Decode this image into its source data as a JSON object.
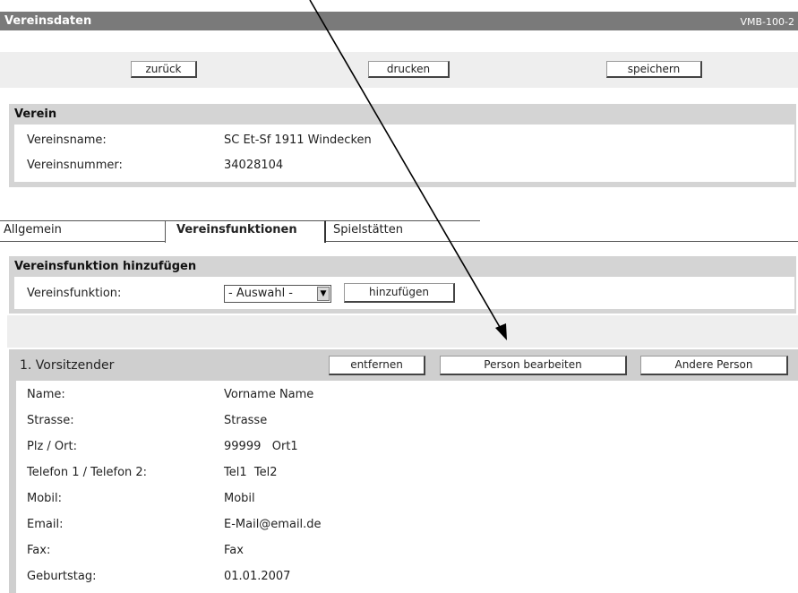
{
  "header": {
    "title": "Vereinsdaten",
    "code": "VMB-100-2"
  },
  "toolbar": {
    "back": "zurück",
    "print": "drucken",
    "save": "speichern"
  },
  "verein": {
    "heading": "Verein",
    "rows": [
      {
        "label": "Vereinsname:",
        "value": "SC Et-Sf 1911 Windecken"
      },
      {
        "label": "Vereinsnummer:",
        "value": "34028104"
      }
    ]
  },
  "tabs": [
    {
      "label": "Allgemein",
      "active": false
    },
    {
      "label": "Vereinsfunktionen",
      "active": true
    },
    {
      "label": "Spielstätten",
      "active": false
    }
  ],
  "add_function": {
    "heading": "Vereinsfunktion hinzufügen",
    "label": "Vereinsfunktion:",
    "select_value": "- Auswahl -",
    "add_button": "hinzufügen"
  },
  "function_block": {
    "title": "1. Vorsitzender",
    "remove_button": "entfernen",
    "edit_person_button": "Person bearbeiten",
    "other_person_button": "Andere Person",
    "rows": [
      {
        "label": "Name:",
        "value": "Vorname Name"
      },
      {
        "label": "Strasse:",
        "value": "Strasse"
      },
      {
        "label": "Plz / Ort:",
        "value": "99999   Ort1"
      },
      {
        "label": "Telefon 1 / Telefon 2:",
        "value": "Tel1  Tel2"
      },
      {
        "label": "Mobil:",
        "value": "Mobil"
      },
      {
        "label": "Email:",
        "value": "E-Mail@email.de"
      },
      {
        "label": "Fax:",
        "value": "Fax"
      },
      {
        "label": "Geburtstag:",
        "value": "01.01.2007"
      }
    ]
  }
}
